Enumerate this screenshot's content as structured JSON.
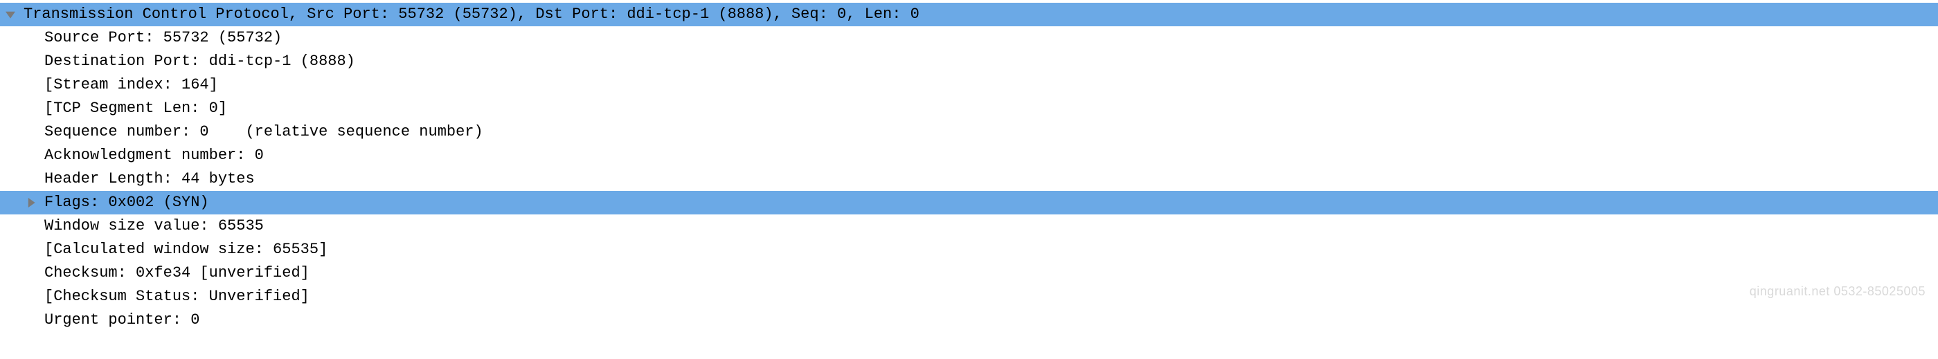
{
  "tree": {
    "header": "Transmission Control Protocol, Src Port: 55732 (55732), Dst Port: ddi-tcp-1 (8888), Seq: 0, Len: 0",
    "source_port": "Source Port: 55732 (55732)",
    "destination_port": "Destination Port: ddi-tcp-1 (8888)",
    "stream_index": "[Stream index: 164]",
    "tcp_segment_len": "[TCP Segment Len: 0]",
    "sequence_number": "Sequence number: 0    (relative sequence number)",
    "ack_number": "Acknowledgment number: 0",
    "header_length": "Header Length: 44 bytes",
    "flags": "Flags: 0x002 (SYN)",
    "window_size": "Window size value: 65535",
    "calc_window_size": "[Calculated window size: 65535]",
    "checksum": "Checksum: 0xfe34 [unverified]",
    "checksum_status": "[Checksum Status: Unverified]",
    "urgent_pointer": "Urgent pointer: 0"
  },
  "watermark": "qingruanit.net 0532-85025005"
}
